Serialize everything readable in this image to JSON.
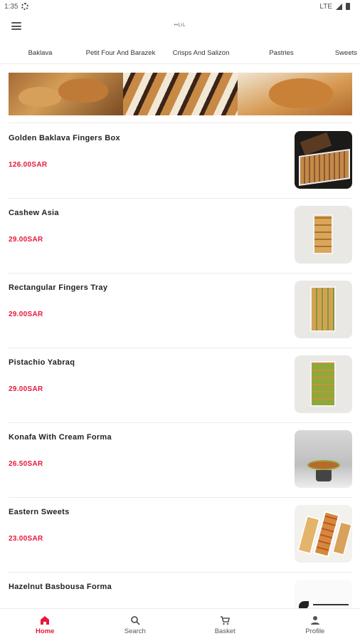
{
  "status_bar": {
    "time": "1:35",
    "network": "LTE"
  },
  "app_bar": {
    "logo_text": "••LiL"
  },
  "tabs": [
    {
      "label": "Baklava",
      "active": true
    },
    {
      "label": "Petit Four And Barazek"
    },
    {
      "label": "Crisps And Salizon"
    },
    {
      "label": "Pastries"
    },
    {
      "label": "Sweets"
    }
  ],
  "products": [
    {
      "name": "Golden Baklava Fingers Box",
      "price": "126.00SAR"
    },
    {
      "name": "Cashew Asia",
      "price": "29.00SAR"
    },
    {
      "name": "Rectangular Fingers Tray",
      "price": "29.00SAR"
    },
    {
      "name": "Pistachio Yabraq",
      "price": "29.00SAR"
    },
    {
      "name": "Konafa With Cream Forma",
      "price": "26.50SAR"
    },
    {
      "name": "Eastern Sweets",
      "price": "23.00SAR"
    },
    {
      "name": "Hazelnut Basbousa Forma",
      "price": ""
    }
  ],
  "bottom_nav": [
    {
      "label": "Home",
      "icon": "home-icon",
      "active": true
    },
    {
      "label": "Search",
      "icon": "search-icon"
    },
    {
      "label": "Basket",
      "icon": "cart-icon"
    },
    {
      "label": "Profile",
      "icon": "profile-icon"
    }
  ],
  "colors": {
    "accent": "#e8173b",
    "text": "#222222"
  }
}
